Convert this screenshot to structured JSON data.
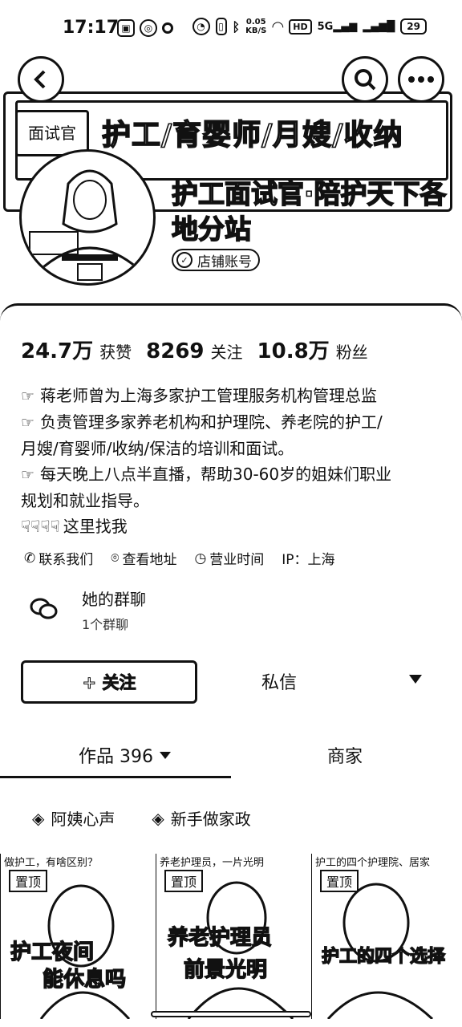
{
  "status_bar": {
    "time": "17:17",
    "network_speed": "0.05\nKB/S",
    "hd_label": "HD",
    "signal_label": "5G",
    "battery": "29"
  },
  "header": {
    "banner_tag": "面试官",
    "banner_title": "护工/育婴师/月嫂/收纳",
    "shop_name": "护工面试官·陪护天下各地分站",
    "badge": "店铺账号"
  },
  "stats": [
    {
      "value": "24.7万",
      "label": "获赞"
    },
    {
      "value": "8269",
      "label": "关注"
    },
    {
      "value": "10.8万",
      "label": "粉丝"
    }
  ],
  "bio": {
    "lines": [
      "蒋老师曾为上海多家护工管理服务机构管理总监",
      "负责管理多家养老机构和护理院、养老院的护工/",
      "月嫂/育婴师/收纳/保洁的培训和面试。",
      "每天晚上八点半直播，帮助30-60岁的姐妹们职业",
      "规划和就业指导。"
    ],
    "find_me": "这里找我"
  },
  "info": {
    "contact": "联系我们",
    "address": "查看地址",
    "hours": "营业时间",
    "ip": "IP：上海"
  },
  "group_chat": {
    "title": "她的群聊",
    "count": "1个群聊"
  },
  "actions": {
    "follow": "+ 关注",
    "message": "私信"
  },
  "tabs": {
    "works": "作品 396",
    "merchant": "商家"
  },
  "collections": [
    "阿姨心声",
    "新手做家政"
  ],
  "videos": [
    {
      "caption": "做护工，有啥区别？",
      "pin": "置顶",
      "text_lines": [
        "护工夜间",
        "能休息吗"
      ]
    },
    {
      "caption": "养老护理员，一片光明",
      "pin": "置顶",
      "text_lines": [
        "养老护理员",
        "前景光明"
      ]
    },
    {
      "caption": "护工的四个护理院、居家",
      "pin": "置顶",
      "text_lines": [
        "护工的四个选择"
      ]
    }
  ]
}
